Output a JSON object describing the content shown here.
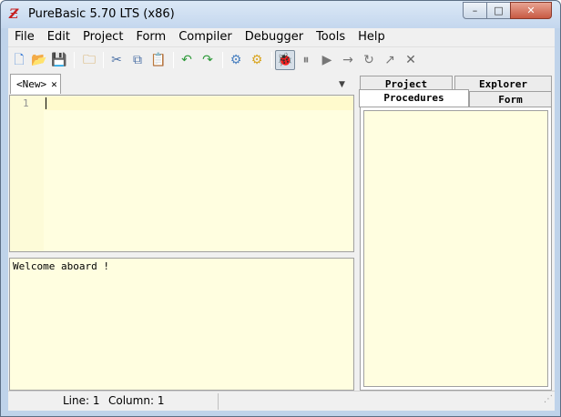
{
  "window": {
    "title": "PureBasic 5.70 LTS (x86)",
    "icon": "purebasic-icon",
    "minimize": "–",
    "maximize": "□",
    "close": "✕"
  },
  "menu": [
    "File",
    "Edit",
    "Project",
    "Form",
    "Compiler",
    "Debugger",
    "Tools",
    "Help"
  ],
  "toolbar": [
    {
      "name": "new-file-icon",
      "glyph": "🗋",
      "color": "#3a7bd5"
    },
    {
      "name": "open-file-icon",
      "glyph": "📂",
      "color": "#d9a520"
    },
    {
      "name": "save-icon",
      "glyph": "💾",
      "color": "#3a6fb0"
    },
    {
      "name": "close-file-icon",
      "glyph": "🗀",
      "color": "#c88a20"
    },
    {
      "name": "cut-icon",
      "glyph": "✂",
      "color": "#4a6fa5"
    },
    {
      "name": "copy-icon",
      "glyph": "⧉",
      "color": "#4a6fa5"
    },
    {
      "name": "paste-icon",
      "glyph": "📋",
      "color": "#a07030"
    },
    {
      "name": "undo-icon",
      "glyph": "↶",
      "color": "#2e9a3a"
    },
    {
      "name": "redo-icon",
      "glyph": "↷",
      "color": "#2e9a3a"
    },
    {
      "name": "compile-run-icon",
      "glyph": "⚙",
      "color": "#4a80c0"
    },
    {
      "name": "build-icon",
      "glyph": "⚙",
      "color": "#d9a520"
    },
    {
      "name": "debugger-icon",
      "glyph": "🐞",
      "color": "#3aa03a"
    },
    {
      "name": "pause-icon",
      "glyph": "⏸",
      "color": "#777"
    },
    {
      "name": "continue-icon",
      "glyph": "▶",
      "color": "#777"
    },
    {
      "name": "step-icon",
      "glyph": "→",
      "color": "#777"
    },
    {
      "name": "step-over-icon",
      "glyph": "↻",
      "color": "#777"
    },
    {
      "name": "step-out-icon",
      "glyph": "↗",
      "color": "#777"
    },
    {
      "name": "kill-program-icon",
      "glyph": "✕",
      "color": "#666"
    }
  ],
  "editor": {
    "tab_label": "<New>",
    "tab_close": "✕",
    "line_number": "1"
  },
  "output": {
    "text": "Welcome aboard !"
  },
  "right_panel": {
    "tabs_top": [
      "Project",
      "Explorer"
    ],
    "tabs_bottom": [
      "Procedures",
      "Form"
    ],
    "selected": "Procedures"
  },
  "status": {
    "line": "Line: 1",
    "column": "Column: 1"
  }
}
